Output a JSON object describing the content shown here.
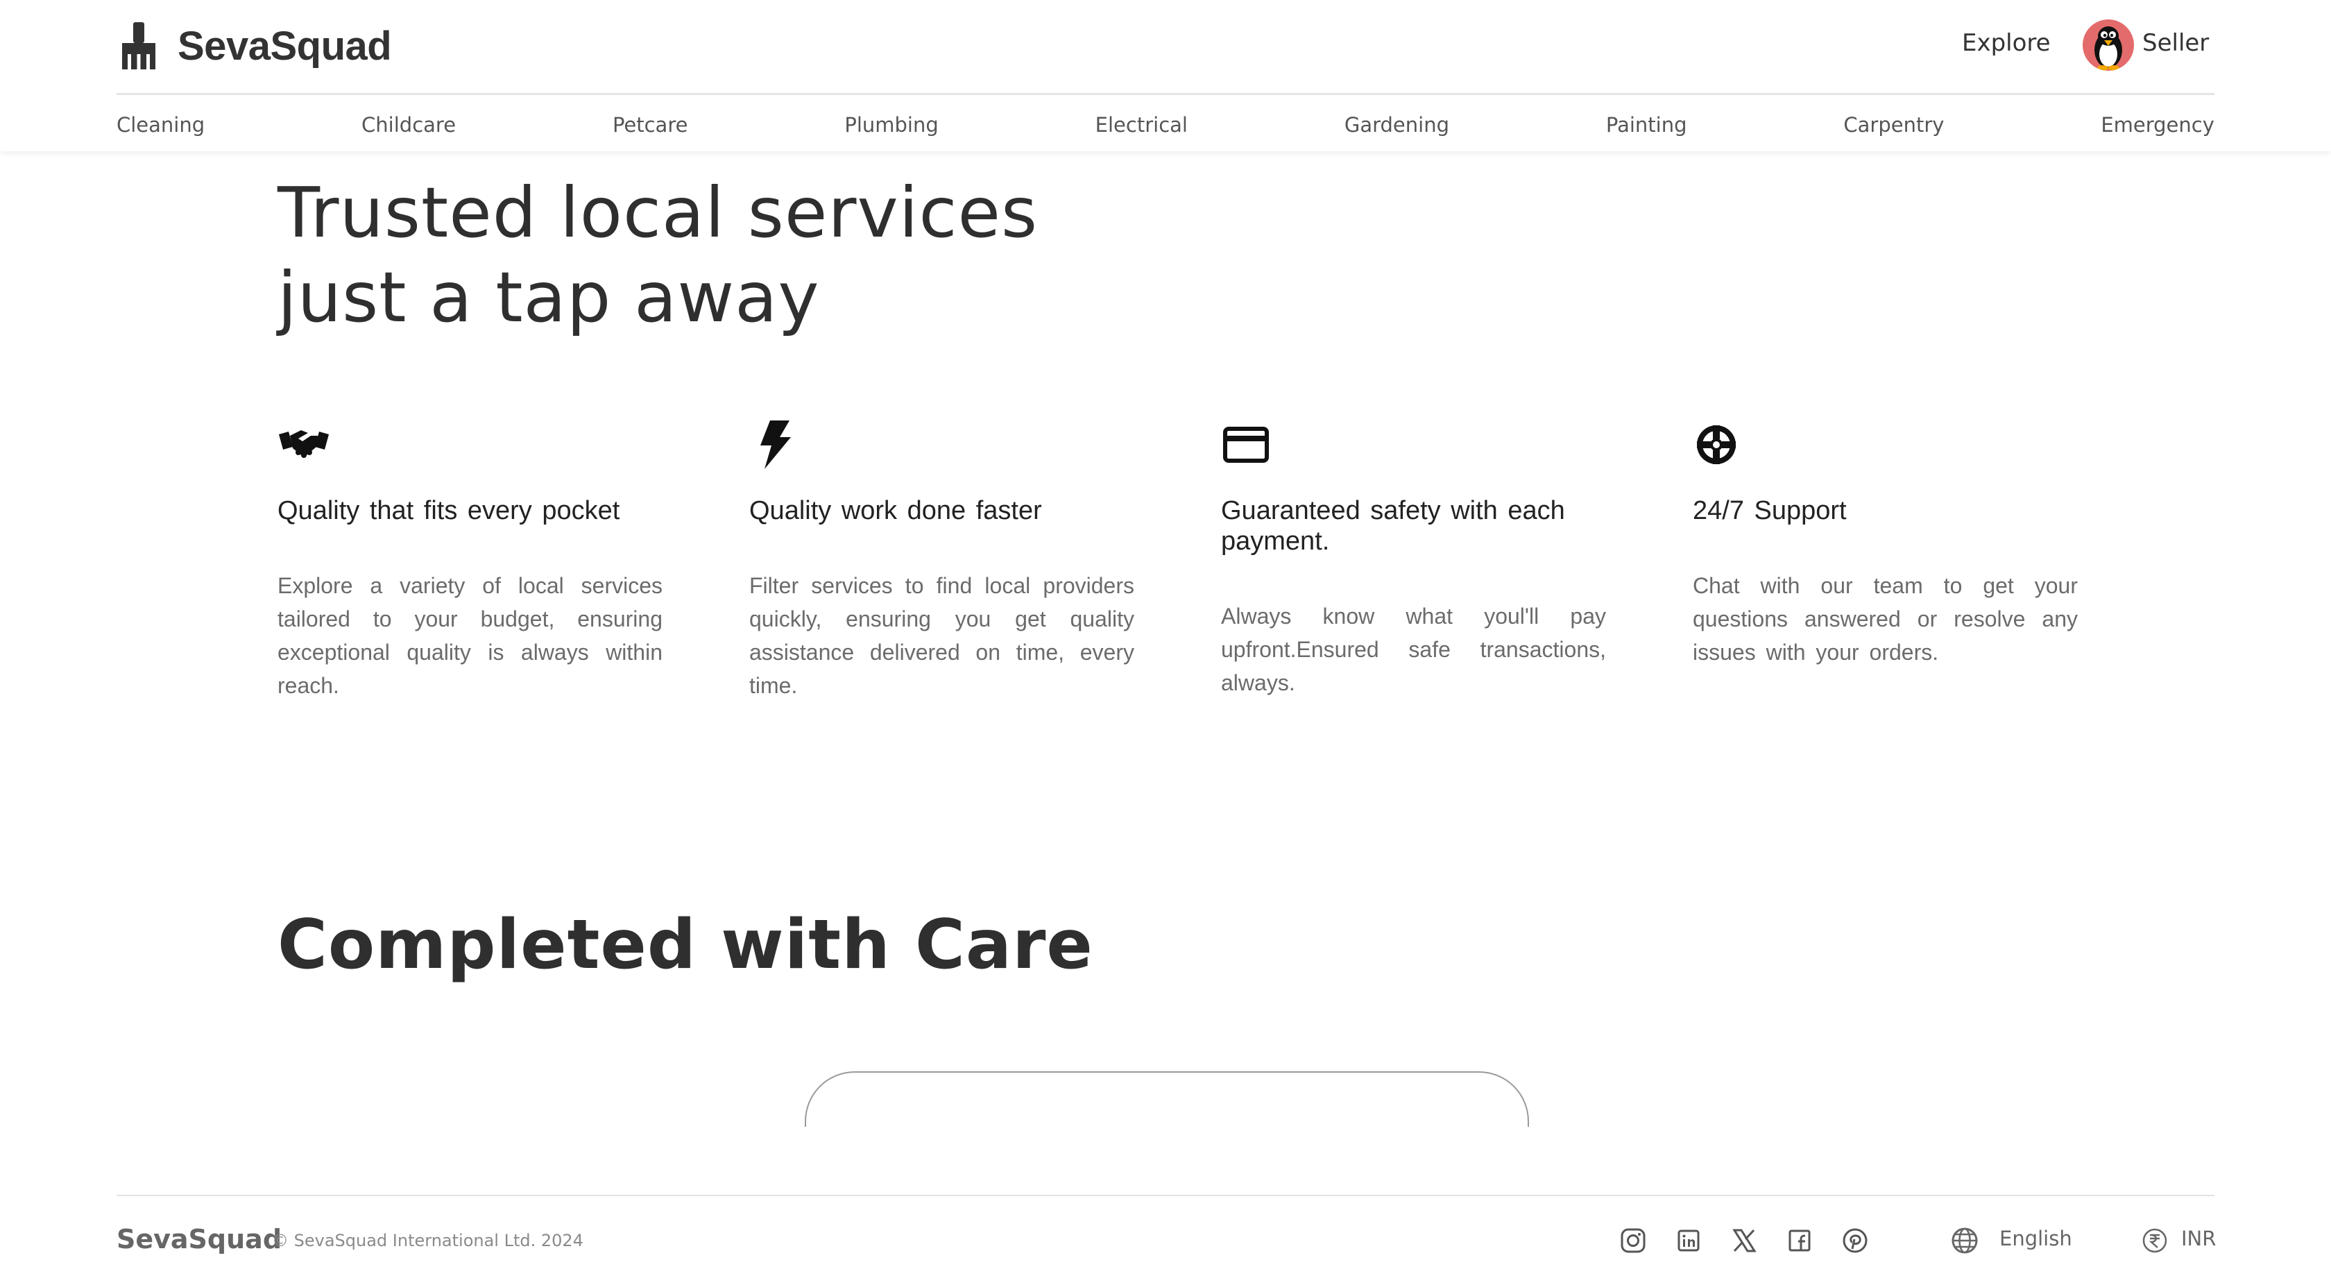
{
  "brand": {
    "name": "SevaSquad",
    "icon": "broom-icon"
  },
  "header": {
    "explore_label": "Explore",
    "seller_label": "Seller",
    "seller_avatar": "penguin-avatar"
  },
  "categories": [
    "Cleaning",
    "Childcare",
    "Petcare",
    "Plumbing",
    "Electrical",
    "Gardening",
    "Painting",
    "Carpentry",
    "Emergency"
  ],
  "hero": {
    "line1": "Trusted local services",
    "line2": "just a tap away"
  },
  "features": [
    {
      "icon": "handshake-icon",
      "title": "Quality that fits every pocket",
      "description": "Explore a variety of local services tailored to your budget, ensuring exceptional quality is always within reach."
    },
    {
      "icon": "lightning-bolt-icon",
      "title": "Quality work done faster",
      "description": "Filter services to find local providers quickly, ensuring you get quality assistance delivered on time, every time."
    },
    {
      "icon": "credit-card-icon",
      "title": "Guaranteed safety with each payment.",
      "description": "Always know what youl'll pay upfront.Ensured safe transactions, always."
    },
    {
      "icon": "lifebuoy-icon",
      "title": "24/7 Support",
      "description": "Chat with our team to get your questions answered or resolve any issues with your orders."
    }
  ],
  "care": {
    "title": "Completed with Care"
  },
  "footer": {
    "brand": "SevaSquad",
    "copyright": "© SevaSquad International Ltd. 2024",
    "socials": [
      "instagram-icon",
      "linkedin-icon",
      "x-twitter-icon",
      "facebook-icon",
      "pinterest-icon"
    ],
    "language_label": "English",
    "currency_label": "INR"
  },
  "colors": {
    "text": "#333333",
    "muted": "#6b6b6b",
    "avatar_bg": "#e46b6b",
    "divider": "#e4e4e4"
  }
}
